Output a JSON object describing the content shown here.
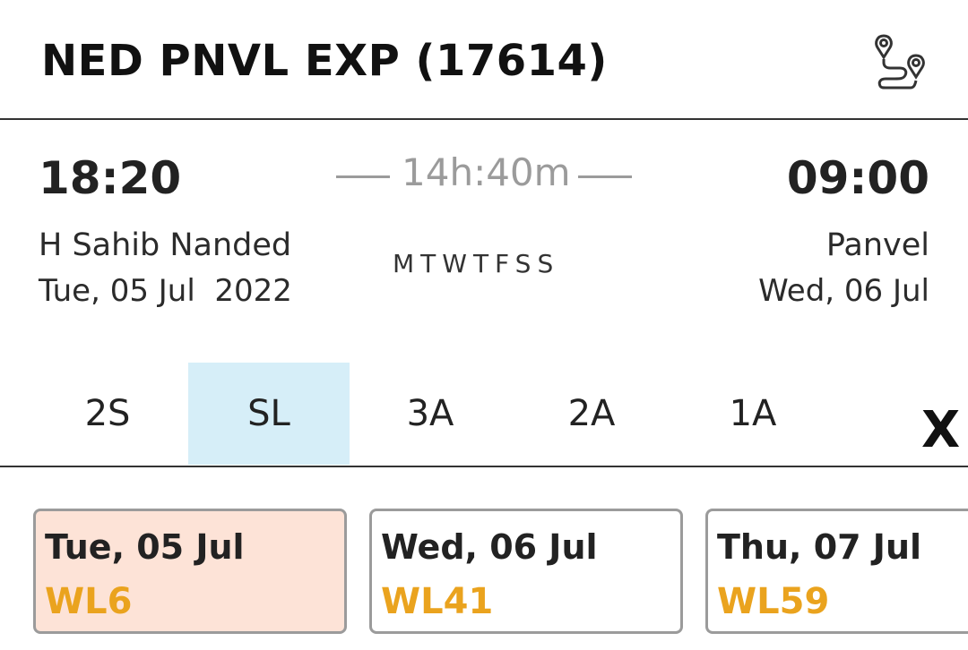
{
  "header": {
    "title": "NED PNVL EXP (17614)",
    "route_icon": "route-map-icon"
  },
  "journey": {
    "departure_time": "18:20",
    "arrival_time": "09:00",
    "duration": "14h:40m",
    "from_station": "H Sahib Nanded",
    "to_station": "Panvel",
    "departure_date": "Tue, 05 Jul  2022",
    "arrival_date": "Wed, 06 Jul",
    "running_days": "MTWTFSS"
  },
  "class_tabs": [
    {
      "label": "2S",
      "selected": false
    },
    {
      "label": "SL",
      "selected": true
    },
    {
      "label": "3A",
      "selected": false
    },
    {
      "label": "2A",
      "selected": false
    },
    {
      "label": "1A",
      "selected": false
    }
  ],
  "close_label": "X",
  "availability": [
    {
      "date": "Tue, 05 Jul",
      "status": "WL6",
      "selected": true
    },
    {
      "date": "Wed, 06 Jul",
      "status": "WL41",
      "selected": false
    },
    {
      "date": "Thu, 07 Jul",
      "status": "WL59",
      "selected": false
    }
  ],
  "colors": {
    "waitlist": "#eaa31e",
    "selected_tab_bg": "#d6eef8",
    "selected_card_bg": "#fde3d7",
    "muted_text": "#9b9b9b"
  }
}
